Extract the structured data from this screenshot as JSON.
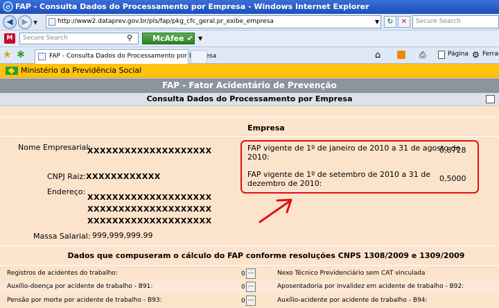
{
  "window": {
    "title": "FAP - Consulta Dados do Processamento por Empresa - Windows Internet Explorer"
  },
  "browser": {
    "address": "http://www2.dataprev.gov.br/pls/fap/pkg_cfc_geral.pr_exibe_empresa",
    "search_placeholder": "Secure Search",
    "toolbar_search_placeholder": "Secure Search",
    "mcafee_label": "McAfee",
    "tab_title": "FAP - Consulta Dados do Processamento por Empresa",
    "page_menu": "Página",
    "tools_menu": "Ferrame"
  },
  "site": {
    "ministry": "Ministério da Previdência Social",
    "app_title": "FAP - Fator Acidentário de Prevenção",
    "page_title": "Consulta Dados do Processamento por Empresa"
  },
  "empresa": {
    "heading": "Empresa",
    "nome_label": "Nome Empresarial:",
    "nome_value": "XXXXXXXXXXXXXXXXXXXX",
    "cnpj_label": "CNPJ Raiz:",
    "cnpj_value": "XXXXXXXXXXXX",
    "endereco_label": "Endereço:",
    "endereco_lines": [
      "XXXXXXXXXXXXXXXXXXXX",
      "XXXXXXXXXXXXXXXXXXXX",
      "XXXXXXXXXXXXXXXXXXXX"
    ],
    "massa_label": "Massa Salarial:",
    "massa_value": "999,999,999.99"
  },
  "fap": [
    {
      "period_line1": "FAP vigente de 1º de janeiro de 2010 a 31 de agosto de",
      "period_line2": "2010:",
      "value": "0,8728"
    },
    {
      "period_line1": "FAP vigente de 1º de setembro de 2010 a 31 de",
      "period_line2": "dezembro de 2010:",
      "value": "0,5000"
    }
  ],
  "dados": {
    "heading": "Dados que compuseram o cálculo do FAP conforme resoluções CNPS 1308/2009 e 1309/2009",
    "rows": [
      {
        "left_label": "Registros de acidentes do trabalho:",
        "left_value": "0",
        "right_label": "Nexo Técnico Previdenciário sem CAT vinculada"
      },
      {
        "left_label": "Auxílio-doença por acidente de trabalho - B91:",
        "left_value": "0",
        "right_label": "Aposentadoria por invalidez em acidente de trabalho - B92:"
      },
      {
        "left_label": "Pensão por morte por acidente de trabalho - B93:",
        "left_value": "0",
        "right_label": "Auxílio-acidente por acidente de trabalho - B94:"
      }
    ],
    "button_label": "..."
  },
  "colors": {
    "ministry_bar": "#ffc20e",
    "header_gray": "#8c949c",
    "page_bg": "#fce4cc",
    "highlight": "#e01010"
  }
}
